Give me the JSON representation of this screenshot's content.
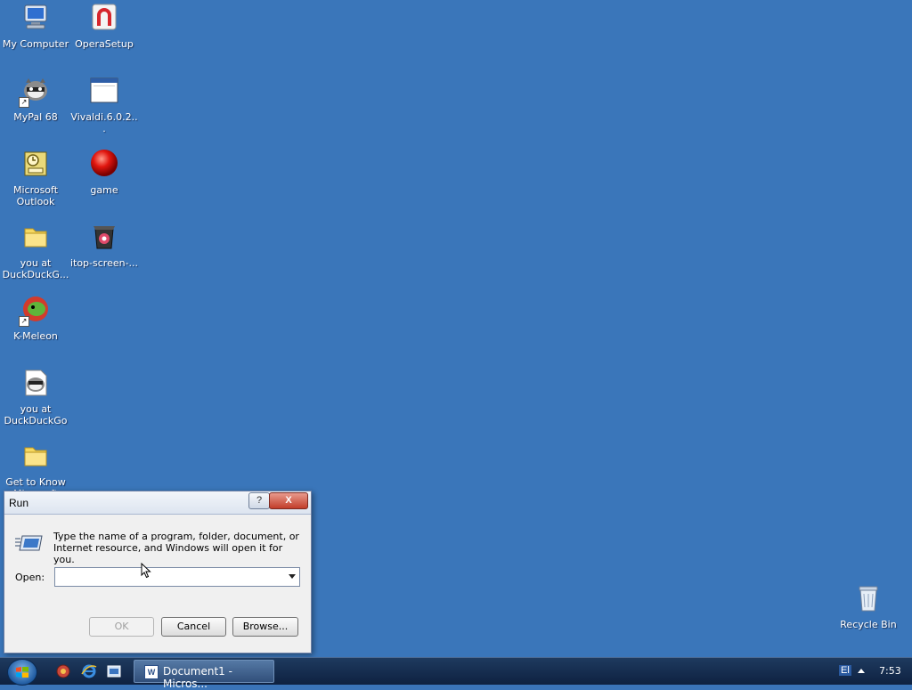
{
  "desktop": {
    "icons": [
      {
        "label": "My Computer",
        "icon": "computer-icon"
      },
      {
        "label": "OperaSetup",
        "icon": "opera-icon"
      },
      {
        "label": "MyPal 68",
        "icon": "raccoon-icon"
      },
      {
        "label": "Vivaldi.6.0.2...",
        "icon": "window-app-icon"
      },
      {
        "label": "Microsoft Outlook",
        "icon": "outlook-icon"
      },
      {
        "label": "game",
        "icon": "red-ball-icon"
      },
      {
        "label": "you at DuckDuckG...",
        "icon": "folder-icon"
      },
      {
        "label": "itop-screen-...",
        "icon": "installer-icon"
      },
      {
        "label": "K-Meleon",
        "icon": "kmeleon-icon"
      },
      {
        "label": "you at DuckDuckGo",
        "icon": "raccoon-icon"
      },
      {
        "label": "Get to Know Microsoft",
        "icon": "folder-icon"
      },
      {
        "label": "Recycle Bin",
        "icon": "recycle-bin-icon"
      }
    ]
  },
  "run_dialog": {
    "title": "Run",
    "help_label": "?",
    "close_label": "X",
    "description": "Type the name of a program, folder, document, or Internet resource, and Windows will open it for you.",
    "open_label": "Open:",
    "open_value": "",
    "ok_label": "OK",
    "cancel_label": "Cancel",
    "browse_label": "Browse..."
  },
  "taskbar": {
    "task_label": "Document1 - Micros...",
    "language": "El",
    "clock": "7:53"
  }
}
